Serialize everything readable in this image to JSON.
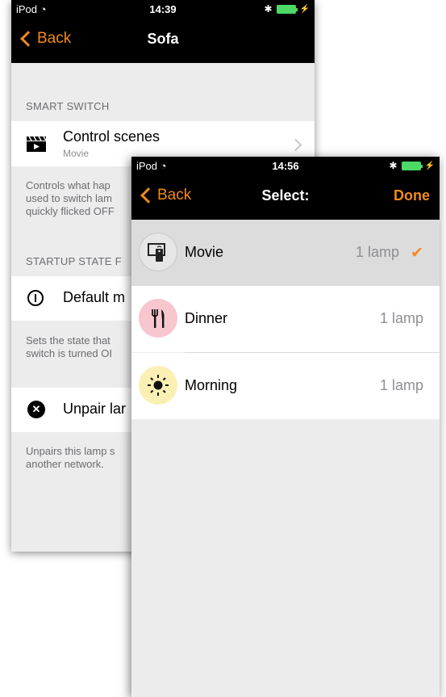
{
  "back_screen": {
    "status": {
      "carrier": "iPod",
      "time": "14:39"
    },
    "nav": {
      "back": "Back",
      "title": "Sofa"
    },
    "smart_switch_header": "SMART SWITCH",
    "control_scenes": {
      "label": "Control scenes",
      "sub": "Movie"
    },
    "controls_note": "Controls what hap\nused to switch lam\nquickly flicked OFF",
    "startup_header": "STARTUP STATE F",
    "default_mode": {
      "label": "Default m"
    },
    "startup_note": "Sets the state that\nswitch is turned OI",
    "unpair": {
      "label": "Unpair lar"
    },
    "unpair_note": "Unpairs this lamp s\nanother network."
  },
  "front_screen": {
    "status": {
      "carrier": "iPod",
      "time": "14:56"
    },
    "nav": {
      "back": "Back",
      "title": "Select:",
      "done": "Done"
    },
    "scenes": [
      {
        "name": "Movie",
        "count": "1 lamp",
        "selected": true,
        "icon": "remote-icon",
        "color": "#e6e6e6"
      },
      {
        "name": "Dinner",
        "count": "1 lamp",
        "selected": false,
        "icon": "cutlery-icon",
        "color": "#f7c6cf"
      },
      {
        "name": "Morning",
        "count": "1 lamp",
        "selected": false,
        "icon": "sun-icon",
        "color": "#fbf0b3"
      }
    ]
  },
  "accent_color": "#f08a1c"
}
